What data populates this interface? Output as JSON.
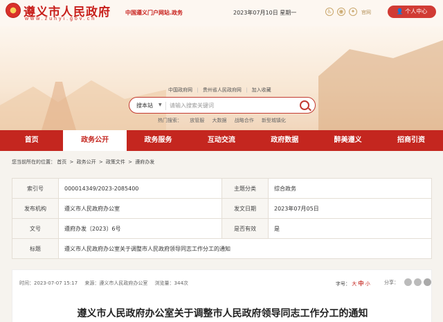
{
  "header": {
    "site_title": "遵义市人民政府",
    "site_url": "www.zunyi.gov.cn",
    "slogan": "中国遵义门户网站.政务",
    "date": "2023年07月10日  星期一",
    "weibo_label": "官网",
    "personal_button": "个人中心",
    "icons": [
      "accessibility-icon",
      "eye-icon",
      "weibo-icon",
      "user-icon"
    ]
  },
  "banner": {
    "quick_links": [
      "中国政府网",
      "贵州省人民政府网",
      "加入收藏"
    ],
    "search": {
      "site_label": "搜本站",
      "placeholder": "请输入搜索关键词"
    },
    "hot_search_label": "热门搜索：",
    "hot_search": [
      "放管服",
      "大数据",
      "战略合作",
      "新型城镇化"
    ]
  },
  "nav": {
    "items": [
      "首页",
      "政务公开",
      "政务服务",
      "互动交流",
      "政府数据",
      "醉美遵义",
      "招商引资"
    ],
    "active": "政务公开"
  },
  "breadcrumb": {
    "prefix": "您当前所在的位置：",
    "items": [
      "首页",
      "政务公开",
      "政策文件",
      "遵府办发"
    ]
  },
  "info_table": {
    "index_key": "索引号",
    "index_val": "000014349/2023-2085400",
    "topic_key": "主题分类",
    "topic_val": "综合政务",
    "issuer_key": "发布机构",
    "issuer_val": "遵义市人民政府办公室",
    "date_key": "发文日期",
    "date_val": "2023年07月05日",
    "doc_key": "文号",
    "doc_val": "遵府办发〔2023〕6号",
    "valid_key": "是否有效",
    "valid_val": "是",
    "title_key": "标题",
    "title_val": "遵义市人民政府办公室关于调整市人民政府领导同志工作分工的通知"
  },
  "article": {
    "time": "时间：2023-07-07 15:17",
    "source": "来源：遵义市人民政府办公室",
    "views": "浏览量：344次",
    "fontsize_label": "字号：",
    "fontsize_large": "大",
    "fontsize_medium": "中",
    "fontsize_small": "小",
    "share_label": "分享：",
    "title": "遵义市人民政府办公室关于调整市人民政府领导同志工作分工的通知"
  }
}
